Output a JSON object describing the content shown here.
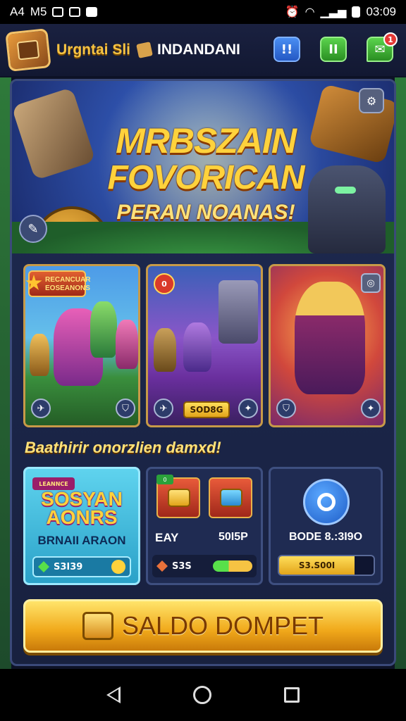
{
  "status_bar": {
    "left_text": "A4",
    "left_text2": "M5",
    "time": "03:09"
  },
  "header": {
    "app_name": "Urgntai Sli",
    "subtitle": "INDANDANI",
    "blue_button_label": "!!",
    "green_button_label": "II",
    "chat_badge": "1"
  },
  "hero": {
    "title_line1": "MRBSZAIN",
    "title_line2": "FOVORICAN",
    "title_line3": "PERAN NOANAS!"
  },
  "cards": [
    {
      "ribbon_text": "RECANCUAR EOSEANONS"
    },
    {
      "level_badge": "0",
      "price": "SOD8G"
    },
    {}
  ],
  "section": {
    "title": "Baathirir onorzlien damxd!"
  },
  "panels": {
    "p1": {
      "tag": "LEANNCE",
      "logo": "SOSYAN AONRS",
      "label": "BRNAII ARAON",
      "value": "S3I39"
    },
    "p2": {
      "tag": "0",
      "label_left": "EAY",
      "label_right": "50I5P",
      "value": "S3S"
    },
    "p3": {
      "label": "BODE 8.:3I9O",
      "bar_text": "S3.S00I",
      "bar_fill_fraction": 0.8
    }
  },
  "cta": {
    "label": "SALDO DOMPET"
  }
}
